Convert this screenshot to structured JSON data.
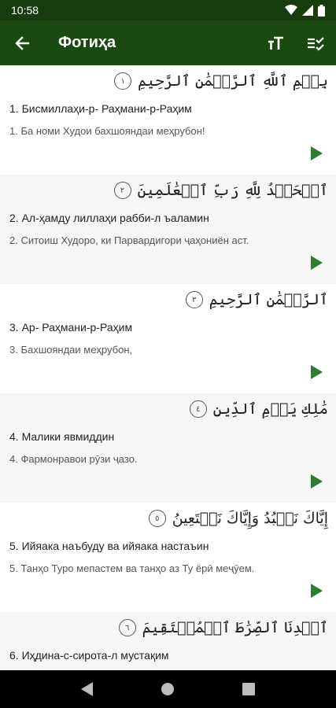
{
  "status_bar": {
    "time": "10:58"
  },
  "app_bar": {
    "title": "Фотиҳа"
  },
  "verses": [
    {
      "arabic": "بِسۡمِ ٱللَّهِ ٱلرَّحۡمَٰنِ ٱلرَّحِيمِ",
      "number_marker": "١",
      "transliteration": "1. Бисмиллаҳи-р- Раҳмани-р-Раҳим",
      "translation": "1. Ба номи Худои бахшояндаи меҳрубон!"
    },
    {
      "arabic": "ٱلۡحَمۡدُ لِلَّهِ رَبِّ ٱلۡعَٰلَمِينَ",
      "number_marker": "٢",
      "transliteration": "2. Ал-ҳамду лиллаҳи рабби-л ъаламин",
      "translation": "2. Ситоиш Худоро, ки Парвардигори ҷаҳониён аст."
    },
    {
      "arabic": "ٱلرَّحۡمَٰنِ ٱلرَّحِيمِ",
      "number_marker": "٣",
      "transliteration": "3. Ар- Раҳмани-р-Раҳим",
      "translation": "3. Бахшояндаи меҳрубон,"
    },
    {
      "arabic": "مَٰلِكِ يَوۡمِ ٱلدِّينِ",
      "number_marker": "٤",
      "transliteration": "4. Малики явмиддин",
      "translation": "4. Фармонравои рӯзи ҷазо."
    },
    {
      "arabic": "إِيَّاكَ نَعۡبُدُ وَإِيَّاكَ نَسۡتَعِينُ",
      "number_marker": "٥",
      "transliteration": "5. Ийяака наъбуду ва ийяака настаъин",
      "translation": "5. Танҳо Туро мепастем ва танҳо аз Ту ёрӣ меҷӯем."
    },
    {
      "arabic": "ٱهۡدِنَا ٱلصِّرَٰطَ ٱلۡمُسۡتَقِيمَ",
      "number_marker": "٦",
      "transliteration": "6. Иҳдина-с-сирота-л мустақим",
      "translation": ""
    }
  ],
  "colors": {
    "app_bar": "#1b4a11",
    "status_bar": "#173d0e",
    "play_accent": "#2e7d2e"
  },
  "icons": {
    "back": "arrow-back-icon",
    "font_size": "text-size-icon",
    "display_options": "checklist-icon",
    "play": "play-icon"
  }
}
